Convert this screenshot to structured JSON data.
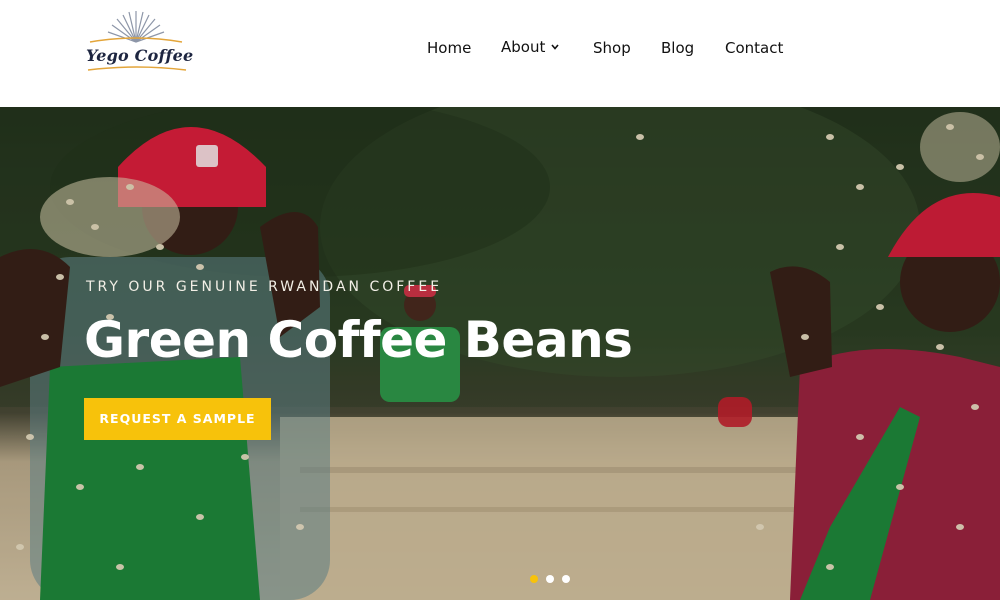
{
  "brand": {
    "name": "Yego Coffee",
    "accent": "#f7c20b"
  },
  "nav": {
    "items": [
      {
        "label": "Home"
      },
      {
        "label": "About",
        "has_dropdown": true
      },
      {
        "label": "Shop"
      },
      {
        "label": "Blog"
      },
      {
        "label": "Contact"
      }
    ]
  },
  "hero": {
    "tagline": "TRY OUR GENUINE RWANDAN COFFEE",
    "title": "Green Coffee Beans",
    "cta_label": "REQUEST A SAMPLE",
    "slides": {
      "count": 3,
      "active": 1
    }
  },
  "icons": [
    "sunburst-logo-icon",
    "chevron-down-icon"
  ]
}
